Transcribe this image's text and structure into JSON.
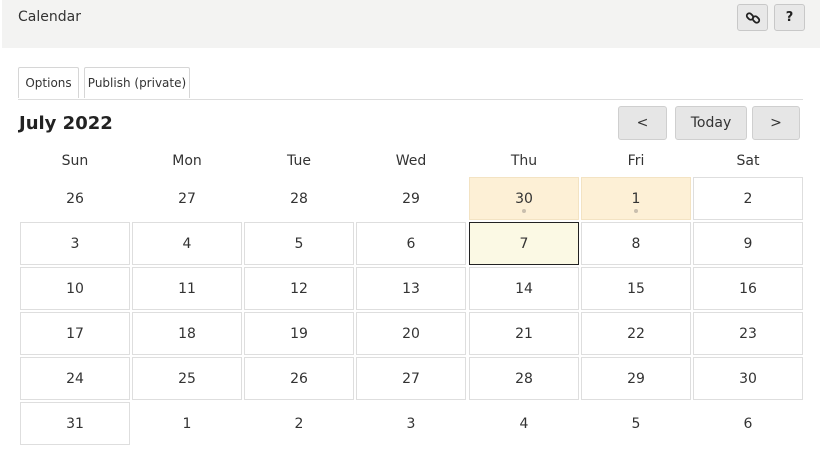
{
  "header": {
    "title": "Calendar",
    "link_icon": "link-icon",
    "help_label": "?"
  },
  "tabs": [
    {
      "label": "Options"
    },
    {
      "label": "Publish (private)"
    }
  ],
  "calendar": {
    "month_title": "July 2022",
    "prev_label": "<",
    "today_label": "Today",
    "next_label": ">",
    "weekdays": [
      "Sun",
      "Mon",
      "Tue",
      "Wed",
      "Thu",
      "Fri",
      "Sat"
    ],
    "weeks": [
      [
        "26",
        "27",
        "28",
        "29",
        "30",
        "1",
        "2"
      ],
      [
        "3",
        "4",
        "5",
        "6",
        "7",
        "8",
        "9"
      ],
      [
        "10",
        "11",
        "12",
        "13",
        "14",
        "15",
        "16"
      ],
      [
        "17",
        "18",
        "19",
        "20",
        "21",
        "22",
        "23"
      ],
      [
        "24",
        "25",
        "26",
        "27",
        "28",
        "29",
        "30"
      ],
      [
        "31",
        "1",
        "2",
        "3",
        "4",
        "5",
        "6"
      ]
    ],
    "colors": {
      "event_bg": "#fdf0d6",
      "today_bg": "#fbf9e4",
      "today_border": "#222222"
    }
  }
}
